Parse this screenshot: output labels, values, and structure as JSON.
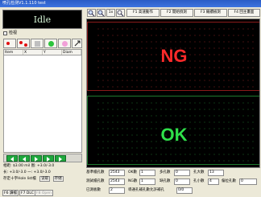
{
  "window": {
    "title": "喷孔检测V1.1.110 test"
  },
  "status": {
    "text": "Idle"
  },
  "left_panel": {
    "checkbox_label": "检视",
    "grid_columns": [
      "Item",
      "X",
      "Y",
      "Diam"
    ],
    "spec1": "相距: $3.00 mil  图: +3.0/-3.0",
    "spec2": "长: +3.0/-3.0     一: +3.0/-3.0",
    "spec3": "存定十字Hole list檔",
    "read_label": "读取",
    "save_label": "存储",
    "buttons": [
      "F6 讀檔",
      "F7 DLC",
      "F8 Open"
    ]
  },
  "toolbar": {
    "zoom_in": "+",
    "zoom_out": "-",
    "one_x": "1x",
    "fit": "⤢",
    "f1": "F1 高速動作",
    "f2": "F2 開始偵測",
    "f3": "F3 繼續檢測",
    "f4": "F4 回主畫面"
  },
  "display": {
    "ng_text": "NG",
    "ok_text": "OK"
  },
  "info": {
    "std_count_label": "基準檔孔數",
    "std_count": "2543",
    "ok_label": "OK數",
    "ok_value": "1",
    "more_label": "多孔數",
    "more_value": "0",
    "big_label": "孔大數",
    "big_value": "13",
    "measured_label": "測試檔孔數",
    "measured": "2543",
    "ng_label": "NG數",
    "ng_value": "1",
    "less_label": "缺孔數",
    "less_value": "0",
    "small_label": "孔小數",
    "small_value": "4",
    "pos_label": "偏位孔數",
    "pos_value": "0",
    "done_label": "已測板數",
    "done_value": "2",
    "remark_label": "導通孔補孔數允許補孔",
    "remark_value": "0/0"
  }
}
